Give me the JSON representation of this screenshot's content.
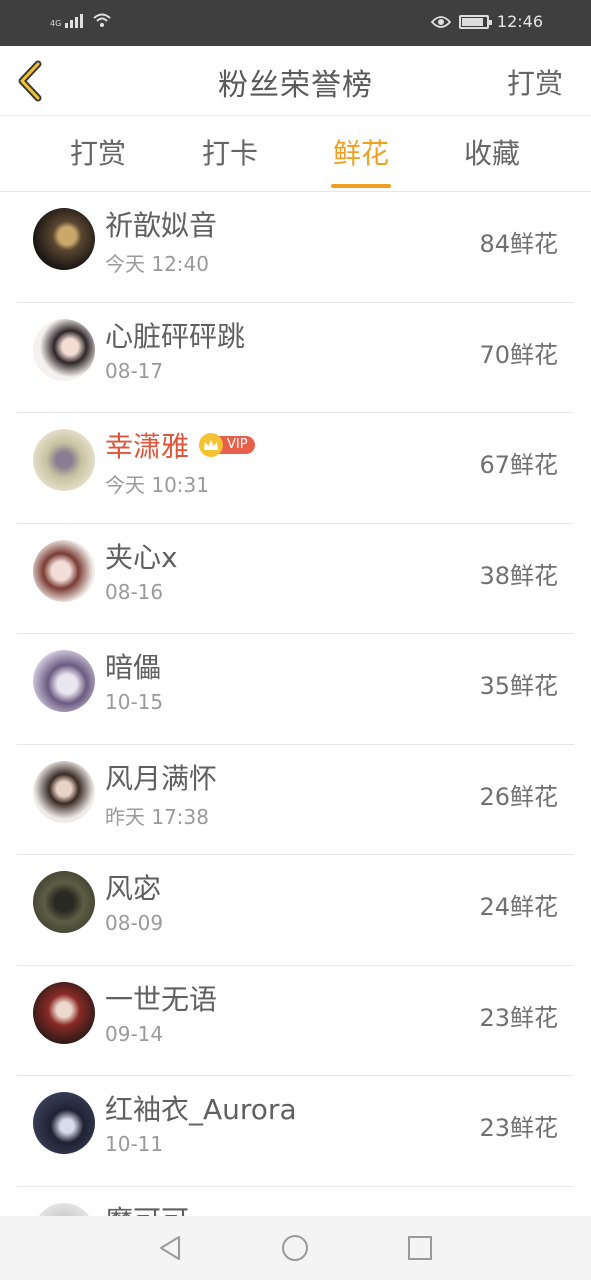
{
  "status_bar": {
    "signal_label": "4G",
    "time": "12:46",
    "battery_level": 0.9,
    "icons": [
      "signal-icon",
      "wifi-icon",
      "eye-icon",
      "battery-icon"
    ]
  },
  "header": {
    "title": "粉丝荣誉榜",
    "action_label": "打赏",
    "back_icon": "chevron-left-icon"
  },
  "tabs": [
    {
      "label": "打赏",
      "active": false
    },
    {
      "label": "打卡",
      "active": false
    },
    {
      "label": "鲜花",
      "active": true
    },
    {
      "label": "收藏",
      "active": false
    }
  ],
  "colors": {
    "accent": "#f0a020",
    "vip_name": "#e0553a",
    "vip_badge": "#e8604a",
    "crown": "#f5c232"
  },
  "fans": [
    {
      "name": "祈歆姒音",
      "time": "今天 12:40",
      "count": "84鲜花",
      "vip": false
    },
    {
      "name": "心脏砰砰跳",
      "time": "08-17",
      "count": "70鲜花",
      "vip": false
    },
    {
      "name": "幸潇雅",
      "time": "今天 10:31",
      "count": "67鲜花",
      "vip": true,
      "vip_label": "VIP"
    },
    {
      "name": "夹心x",
      "time": "08-16",
      "count": "38鲜花",
      "vip": false
    },
    {
      "name": "暗儡",
      "time": "10-15",
      "count": "35鲜花",
      "vip": false
    },
    {
      "name": "风月满怀",
      "time": "昨天 17:38",
      "count": "26鲜花",
      "vip": false
    },
    {
      "name": "风宓",
      "time": "08-09",
      "count": "24鲜花",
      "vip": false
    },
    {
      "name": "一世无语",
      "time": "09-14",
      "count": "23鲜花",
      "vip": false
    },
    {
      "name": "红袖衣_Aurora",
      "time": "10-11",
      "count": "23鲜花",
      "vip": false
    },
    {
      "name": "魔可可",
      "time": "",
      "count": "",
      "vip": false
    }
  ],
  "nav_bar": {
    "icons": [
      "back-triangle-icon",
      "home-circle-icon",
      "recents-square-icon"
    ]
  }
}
